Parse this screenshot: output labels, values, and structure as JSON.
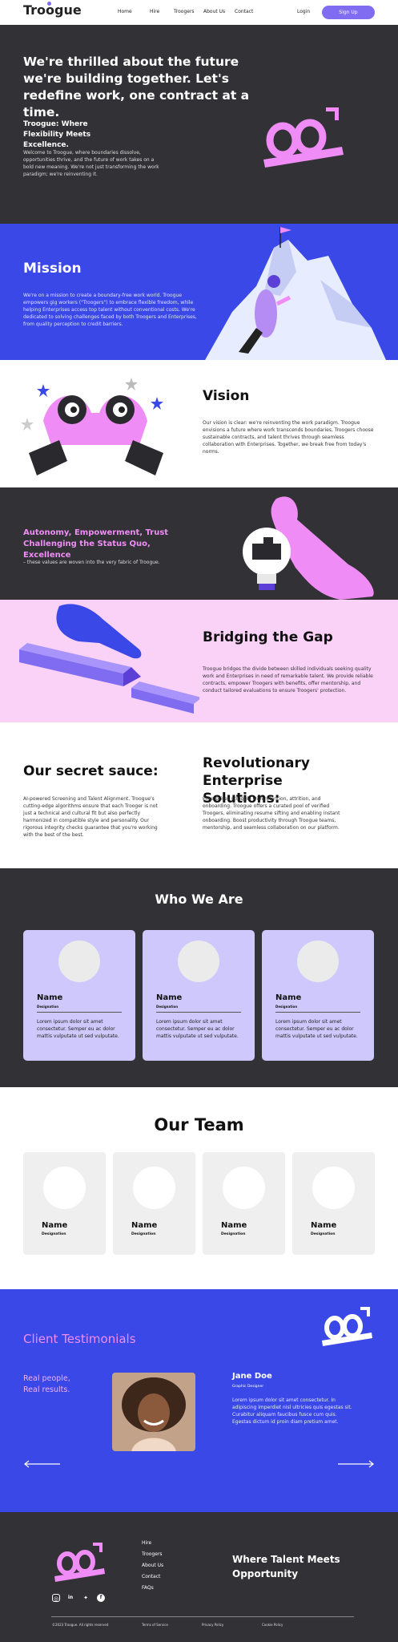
{
  "nav": {
    "logo": "Troogue",
    "links": [
      "Home",
      "Hire",
      "Troogers",
      "About Us",
      "Contact"
    ],
    "login": "Login",
    "signup": "Sign Up"
  },
  "hero": {
    "headline": "We're thrilled about the future we're building together. Let's redefine work, one contract at a time.",
    "subhead": "Troogue: Where Flexibility Meets Excellence.",
    "body": "Welcome to Troogue, where boundaries dissolve, opportunities thrive, and the future of work takes on a bold new meaning. We're not just transforming the work paradigm; we're reinventing it."
  },
  "mission": {
    "title": "Mission",
    "body": "We're on a mission to create a boundary-free work world. Troogue empowers gig workers (\"Troogers\") to embrace flexible freedom, while helping Enterprises access top talent without conventional costs. We're dedicated to solving challenges faced by both Troogers and Enterprises, from quality perception to credit barriers."
  },
  "vision": {
    "title": "Vision",
    "body": "Our vision is clear: we're reinventing the work paradigm. Troogue envisions a future where work transcends boundaries, Troogers choose sustainable contracts, and talent thrives through seamless collaboration with Enterprises. Together, we break free from today's norms."
  },
  "values": {
    "title": "Autonomy, Empowerment, Trust Challenging the Status Quo, Excellence",
    "body": "– these values are woven into the very fabric of Troogue."
  },
  "bridge": {
    "title": "Bridging the Gap",
    "body": "Troogue bridges the divide between skilled individuals seeking quality work and Enterprises in need of remarkable talent. We provide reliable contracts, empower Troogers with benefits, offer mentorship, and conduct tailored evaluations to ensure Troogers' protection."
  },
  "sauce": {
    "title": "Our secret sauce:",
    "body": "AI-powered Screening and Talent Alignment. Troogue's cutting-edge algorithms ensure that each Trooger is not just a technical and cultural fit but also perfectly harmonized in compatible style and personality. Our rigorous integrity checks guarantee that you're working with the best of the best.",
    "enterprise_title": "Revolutionary Enterprise Solutions:",
    "enterprise_body": "Enterprises struggle with retention, attrition, and onboarding. Troogue offers a curated pool of verified Troogers, eliminating resume sifting and enabling instant onboarding. Boost productivity through Troogue teams, mentorship, and seamless collaboration on our platform."
  },
  "who": {
    "title": "Who We Are",
    "cards": [
      {
        "name": "Name",
        "designation": "Designation",
        "text": "Lorem ipsum dolor sit amet consectetur. Semper eu ac dolor mattis vulputate ut sed vulputate."
      },
      {
        "name": "Name",
        "designation": "Designation",
        "text": "Lorem ipsum dolor sit amet consectetur. Semper eu ac dolor mattis vulputate ut sed vulputate."
      },
      {
        "name": "Name",
        "designation": "Designation",
        "text": "Lorem ipsum dolor sit amet consectetur. Semper eu ac dolor mattis vulputate ut sed vulputate."
      }
    ]
  },
  "team": {
    "title": "Our Team",
    "members": [
      {
        "name": "Name",
        "designation": "Designation"
      },
      {
        "name": "Name",
        "designation": "Designation"
      },
      {
        "name": "Name",
        "designation": "Designation"
      },
      {
        "name": "Name",
        "designation": "Designation"
      }
    ]
  },
  "testimonials": {
    "title": "Client Testimonials",
    "tagline": "Real people, Real results.",
    "name": "Jane Doe",
    "role": "Graphic Designer",
    "quote": "Lorem ipsum dolor sit amet consectetur. In adipiscing imperdiet nisl ultricies quis egestas sit. Curabitur aliquam faucibus fusce cum quis. Egestas dictum id proin diam pretium amet."
  },
  "footer": {
    "links": [
      "Hire",
      "Troogers",
      "About Us",
      "Contact",
      "FAQs"
    ],
    "tagline": "Where Talent Meets Opportunity",
    "social": [
      "instagram-icon",
      "linkedin-icon",
      "twitter-icon",
      "facebook-icon"
    ],
    "copyright": "©2023 Troogue. All rights reserved",
    "terms": "Terms of Service",
    "privacy": "Privacy Policy",
    "cookie": "Cookie Policy"
  },
  "colors": {
    "accent": "#7f6cf0",
    "blue": "#3a48e8",
    "dark": "#323236",
    "pink": "#f08cf6",
    "lavender": "#cfc8fc",
    "blush": "#fad2f8"
  }
}
